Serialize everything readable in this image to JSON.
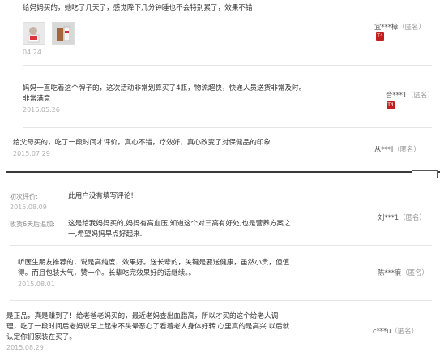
{
  "reviews": [
    {
      "lines": [
        "给妈妈买的，她吃了几天了，感觉降下几分钟睡也不会特别累了，效果不错"
      ],
      "date": "04.24",
      "user": "宜***樟",
      "anon": "（匿名）",
      "level": "T4",
      "has_photos": true
    },
    {
      "lines": [
        "妈妈一直吃着这个牌子的，这次活动非常划算买了4瓶，物流超快，快递人员送货非常及时。",
        "非常满意"
      ],
      "date": "2016.05.26",
      "user": "合***1",
      "anon": "（匿名）",
      "level": "T4"
    },
    {
      "lines": [
        "给父母买的，吃了一段时间才评价，真心不错，疗效好，真心改变了对保健品的印象"
      ],
      "date": "2015.07.29",
      "user": "从***l",
      "anon": "（匿名）"
    },
    {
      "initial_label": "初次评价:",
      "initial_text": "此用户没有填写评论!",
      "initial_date": "2015.08.09",
      "followup_label": "收货6天后追加:",
      "followup_lines": [
        "这是给我妈妈买的,妈妈有高血压,知道这个对三高有好处,也是营养方案之",
        "一,希望妈妈早点好起来."
      ],
      "user": "刘***1",
      "anon": "（匿名）"
    },
    {
      "lines": [
        "听医生朋友推荐的，说是高纯度，效果好。送长辈的，关键是要送健康，虽然小贵，但值",
        "得。而且包装大气，赞一个。长辈吃完效果好的话继续。。"
      ],
      "date": "2015.08.01",
      "user": "陈***廉",
      "anon": "（匿名）"
    },
    {
      "lines": [
        "是正品，真是赚到了！给老爸老妈买的，最近老妈查出血脂高，所以才买的这个给老人调",
        "理，吃了一段时间后老妈说早上起来不头晕恶心了看着老人身体好转 心里真的是高兴 以后就",
        "认定你们家装在买了。"
      ],
      "date": "2015.08.29",
      "user": "c***u",
      "anon": "（匿名）"
    }
  ]
}
